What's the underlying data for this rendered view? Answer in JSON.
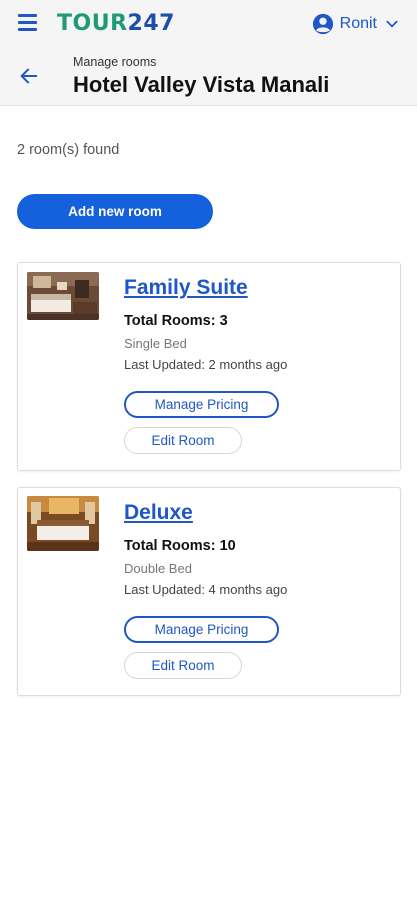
{
  "header": {
    "logo_part1": "TOUR",
    "logo_part2": "247",
    "user_name": "Ronit",
    "menu_icon": "hamburger-menu-icon",
    "user_icon": "account-circle-icon",
    "dropdown_icon": "chevron-down-icon"
  },
  "subheader": {
    "breadcrumb": "Manage rooms",
    "title": "Hotel Valley Vista Manali",
    "back_icon": "arrow-left-icon"
  },
  "main": {
    "count_text": "2 room(s) found",
    "add_button": "Add new room"
  },
  "rooms": [
    {
      "name": "Family Suite",
      "total": "Total Rooms: 3",
      "bed": "Single Bed",
      "updated": "Last Updated: 2 months ago",
      "pricing_label": "Manage Pricing",
      "edit_label": "Edit Room"
    },
    {
      "name": "Deluxe",
      "total": "Total Rooms: 10",
      "bed": "Double Bed",
      "updated": "Last Updated: 4 months ago",
      "pricing_label": "Manage Pricing",
      "edit_label": "Edit Room"
    }
  ],
  "colors": {
    "primary": "#1560dd",
    "link": "#1f56c8",
    "logo_green": "#1f9a74",
    "logo_blue": "#1e4fa8"
  }
}
